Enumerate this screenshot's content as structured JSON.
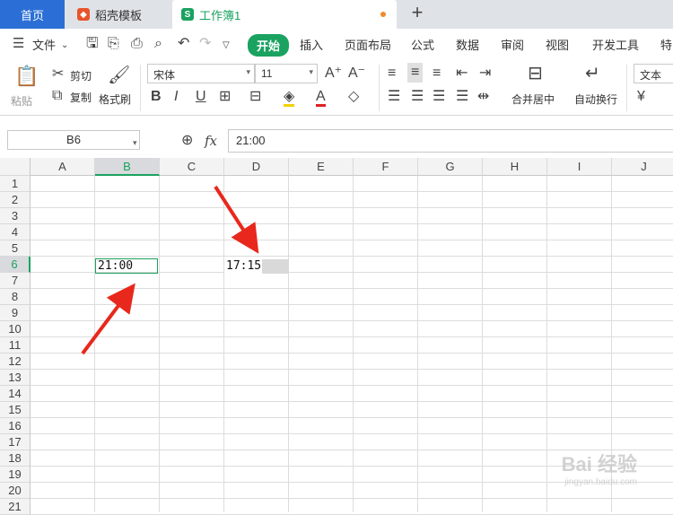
{
  "tabs": {
    "home": "首页",
    "template": "稻壳模板",
    "workbook": "工作簿1",
    "new_tab": "+"
  },
  "menu": {
    "file": "文件",
    "items": [
      "开始",
      "插入",
      "页面布局",
      "公式",
      "数据",
      "审阅",
      "视图",
      "开发工具",
      "特"
    ]
  },
  "ribbon": {
    "paste": "粘贴",
    "cut": "剪切",
    "copy": "复制",
    "format_painter": "格式刷",
    "font_name": "宋体",
    "font_size": "11",
    "merge_center": "合并居中",
    "wrap_text": "自动换行",
    "number_format": "文本",
    "accent": "#1aa260"
  },
  "formula_bar": {
    "name_box": "B6",
    "fx": "fx",
    "value": "21:00"
  },
  "grid": {
    "columns": [
      "A",
      "B",
      "C",
      "D",
      "E",
      "F",
      "G",
      "H",
      "I",
      "J"
    ],
    "rows": [
      "1",
      "2",
      "3",
      "4",
      "5",
      "6",
      "7",
      "8",
      "9",
      "10",
      "11",
      "12",
      "13",
      "14",
      "15",
      "16",
      "17",
      "18",
      "19",
      "20",
      "21"
    ],
    "selected_column": "B",
    "selected_row": "6",
    "cells": {
      "B6": "21:00",
      "D6": "17:15"
    }
  },
  "watermark": {
    "brand": "Bai 经验",
    "url": "jingyan.baidu.com"
  }
}
